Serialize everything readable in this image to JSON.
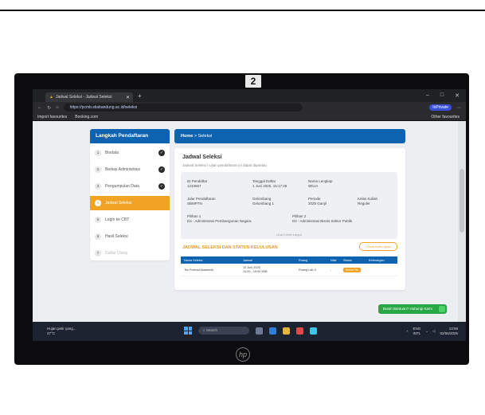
{
  "sticker_number": "2",
  "browser": {
    "tab_title": "Jadwal Seleksi - Jadwal Seleksi",
    "address": "https://pcmb.stiabandung.ac.id/seleksi",
    "private_label": "InPrivate",
    "bookmarks": [
      "Import favourites",
      "Booking.com"
    ],
    "other_favourites": "Other favourites"
  },
  "sidebar": {
    "title": "Langkah Pendaftaran",
    "items": [
      {
        "num": "1",
        "label": "Biodata",
        "state": "done"
      },
      {
        "num": "2",
        "label": "Berkas Administrasi",
        "state": "done"
      },
      {
        "num": "3",
        "label": "Pengumpulan Data",
        "state": "done"
      },
      {
        "num": "4",
        "label": "Jadwal Seleksi",
        "state": "active"
      },
      {
        "num": "5",
        "label": "Login ke CBT",
        "state": "normal"
      },
      {
        "num": "6",
        "label": "Hasil Seleksi",
        "state": "normal"
      },
      {
        "num": "7",
        "label": "Daftar Ulang",
        "state": "disabled"
      }
    ]
  },
  "breadcrumb": {
    "home": "Home",
    "sep": ">",
    "current": "Seleksi"
  },
  "card": {
    "title": "Jadwal Seleksi",
    "subtitle": "Jadwal Seleksi / Ujian pendaftaran ini dapat dipantau",
    "fields": [
      {
        "label": "ID Pendaftar",
        "value": "1234567"
      },
      {
        "label": "Tanggal Daftar",
        "value": "1 Juni 2025, 15:17:48"
      },
      {
        "label": "Nama Lengkap",
        "value": "WILIA"
      },
      {
        "label": "Jalur Pendaftaran",
        "value": "SBMPTN"
      },
      {
        "label": "Gelombang",
        "value": "Gelombang 1"
      },
      {
        "label": "Periode",
        "value": "2025 Ganjil"
      },
      {
        "label": "Kelas Kuliah",
        "value": "Reguler"
      },
      {
        "label": "Pilihan 1",
        "value": "D4 - Administrasi Pembangunan Negara"
      },
      {
        "label": "Pilihan 2",
        "value": "D4 - Administrasi Bisnis Sektor Publik"
      }
    ],
    "more_link": "Lihat Lebih Lanjut",
    "schedule_title": "JADWAL SELEKSI DAN STATUS KELULUSAN",
    "print_button": "Cetak Kartu Ujian",
    "table": {
      "headers": [
        "Nama Seleksi",
        "Jadwal",
        "Ruang",
        "Nilai",
        "Status",
        "Keterangan"
      ],
      "rows": [
        {
          "name": "Tes Potensi Akademik",
          "date": "10 Juni 2025",
          "time": "14:00 - 15:00 WIB",
          "room": "Ruang Lab 3",
          "score": "-",
          "status": "Belum Tes",
          "note": ""
        }
      ]
    }
  },
  "help_button": "Butuh Bantuan? Hubungi Kami",
  "taskbar": {
    "weather_line1": "Hujan petir yang...",
    "weather_line2": "27°C",
    "search_label": "Search",
    "tray_lang": "ENG",
    "tray_region": "INTL",
    "time": "13:59",
    "date": "02/06/2025"
  },
  "colors": {
    "primary": "#0e63b0",
    "accent": "#f1a324",
    "help": "#27a844"
  }
}
